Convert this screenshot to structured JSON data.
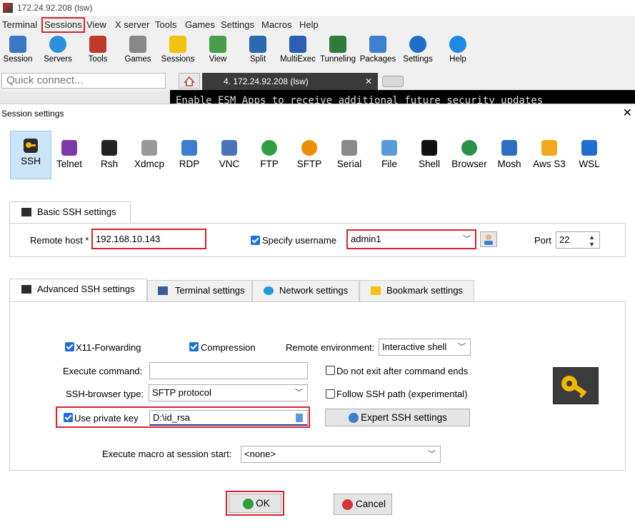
{
  "window_title": "172.24.92.208 (lsw)",
  "menu": [
    "Terminal",
    "Sessions",
    "View",
    "X server",
    "Tools",
    "Games",
    "Settings",
    "Macros",
    "Help"
  ],
  "toolbar": [
    "Session",
    "Servers",
    "Tools",
    "Games",
    "Sessions",
    "View",
    "Split",
    "MultiExec",
    "Tunneling",
    "Packages",
    "Settings",
    "Help"
  ],
  "quick_connect_placeholder": "Quick connect...",
  "terminal_tab": "4. 172.24.92.208 (lsw)",
  "terminal_text": "Enable ESM Apps to receive additional future security updates",
  "dialog": {
    "title": "Session settings",
    "close": "✕",
    "session_types": [
      "SSH",
      "Telnet",
      "Rsh",
      "Xdmcp",
      "RDP",
      "VNC",
      "FTP",
      "SFTP",
      "Serial",
      "File",
      "Shell",
      "Browser",
      "Mosh",
      "Aws S3",
      "WSL"
    ],
    "basic_tab": "Basic SSH settings",
    "remote_host_label": "Remote host *",
    "remote_host_value": "192.168.10.143",
    "specify_username_label": "Specify username",
    "username_value": "admin1",
    "port_label": "Port",
    "port_value": "22",
    "adv_tabs": [
      "Advanced SSH settings",
      "Terminal settings",
      "Network settings",
      "Bookmark settings"
    ],
    "x11_label": "X11-Forwarding",
    "compression_label": "Compression",
    "remote_env_label": "Remote environment:",
    "remote_env_value": "Interactive shell",
    "execute_command_label": "Execute command:",
    "no_exit_label": "Do not exit after command ends",
    "browser_type_label": "SSH-browser type:",
    "browser_type_value": "SFTP protocol",
    "follow_path_label": "Follow SSH path (experimental)",
    "private_key_label": "Use private key",
    "private_key_value": "D:\\id_rsa",
    "expert_button": "Expert SSH settings",
    "macro_label": "Execute macro at session start:",
    "macro_value": "<none>",
    "ok": "OK",
    "cancel": "Cancel"
  },
  "colors": {
    "highlight": "#e0202a",
    "check": "#1e6fd9",
    "selected": "#cce4f7"
  }
}
